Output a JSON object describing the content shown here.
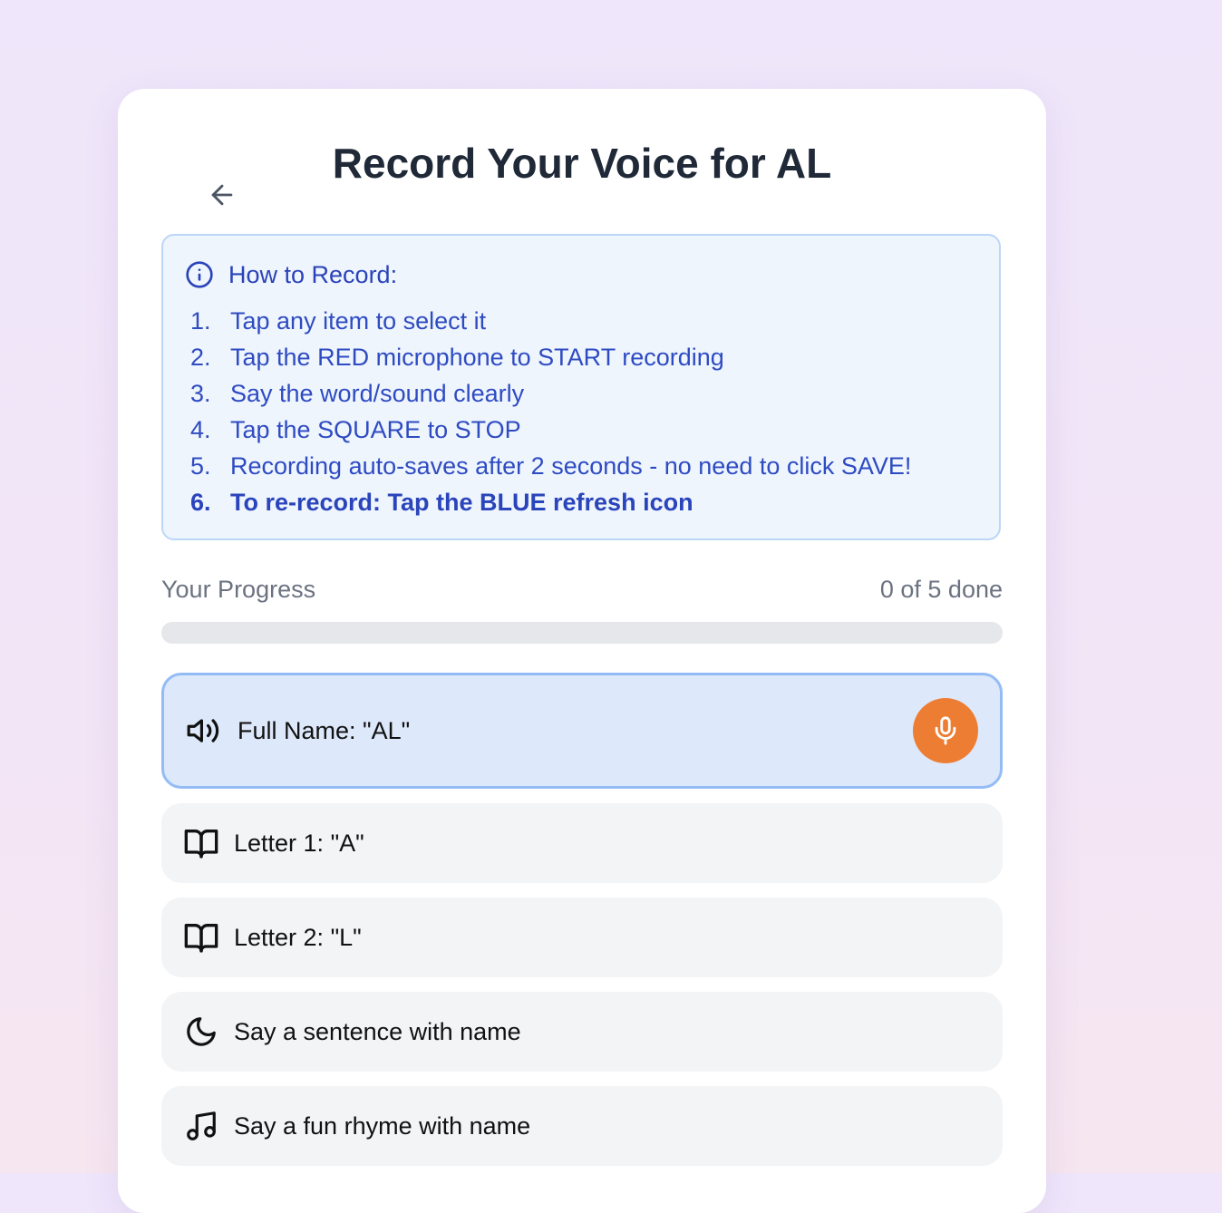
{
  "header": {
    "title": "Record Your Voice for AL"
  },
  "instructions": {
    "title": "How to Record:",
    "steps": [
      {
        "num": "1.",
        "text": "Tap any item to select it"
      },
      {
        "num": "2.",
        "text": "Tap the RED microphone to START recording"
      },
      {
        "num": "3.",
        "text": "Say the word/sound clearly"
      },
      {
        "num": "4.",
        "text": "Tap the SQUARE to STOP"
      },
      {
        "num": "5.",
        "text": "Recording auto-saves after 2 seconds - no need to click SAVE!"
      },
      {
        "num": "6.",
        "text": "To re-record: Tap the BLUE refresh icon"
      }
    ]
  },
  "progress": {
    "label": "Your Progress",
    "count_text": "0 of 5 done",
    "fraction": 0
  },
  "items": [
    {
      "label": "Full Name: \"AL\"",
      "icon": "speaker-icon",
      "selected": true
    },
    {
      "label": "Letter 1: \"A\"",
      "icon": "book-open-icon",
      "selected": false
    },
    {
      "label": "Letter 2: \"L\"",
      "icon": "book-open-icon",
      "selected": false
    },
    {
      "label": "Say a sentence with name",
      "icon": "moon-icon",
      "selected": false
    },
    {
      "label": "Say a fun rhyme with name",
      "icon": "music-note-icon",
      "selected": false
    }
  ],
  "colors": {
    "accent_blue": "#2f4bc2",
    "mic_orange": "#ed7d32",
    "selected_bg": "#dde8fa",
    "selected_border": "#93bcf6"
  }
}
